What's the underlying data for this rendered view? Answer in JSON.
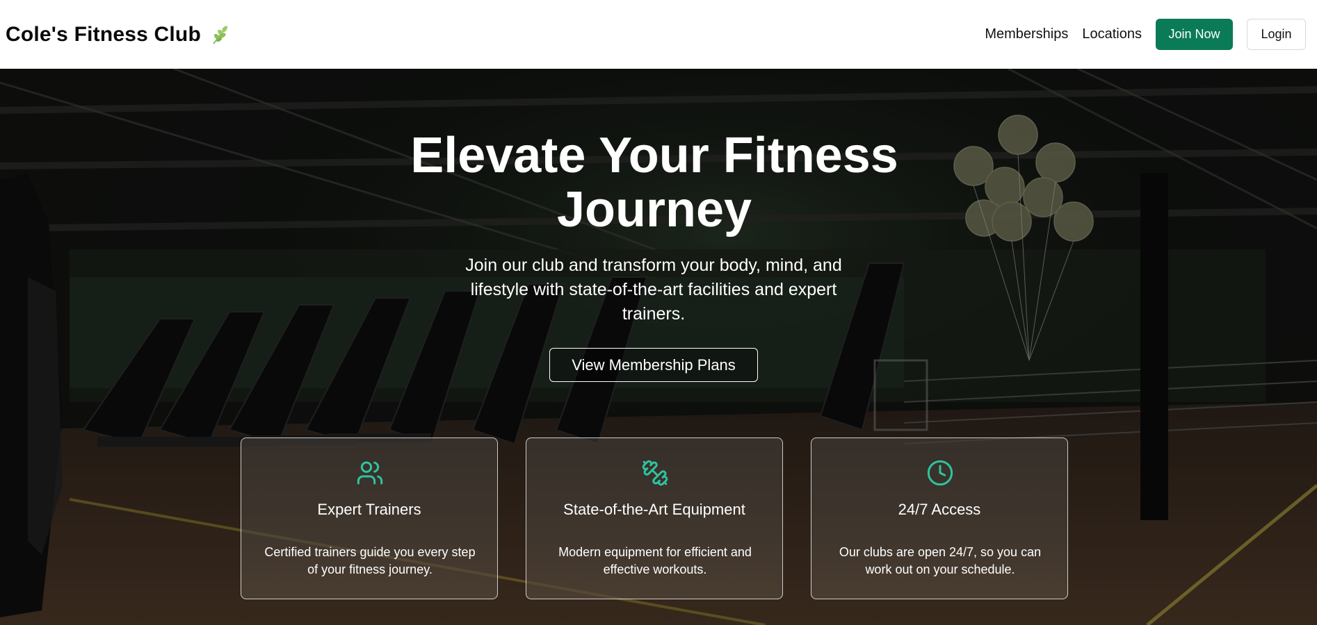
{
  "brand": {
    "title": "Cole's Fitness Club",
    "logo_icon": "leaf-icon",
    "logo_color": "#8bbf5a"
  },
  "nav": {
    "links": [
      "Memberships",
      "Locations"
    ],
    "join_label": "Join Now",
    "login_label": "Login",
    "accent_color": "#0b7a57"
  },
  "hero": {
    "title": "Elevate Your Fitness Journey",
    "subtitle": "Join our club and transform your body, mind, and lifestyle with state-of-the-art facilities and expert trainers.",
    "cta_label": "View Membership Plans"
  },
  "features": [
    {
      "icon": "users-icon",
      "title": "Expert Trainers",
      "description": "Certified trainers guide you every step of your fitness journey."
    },
    {
      "icon": "dumbbell-icon",
      "title": "State-of-the-Art Equipment",
      "description": "Modern equipment for efficient and effective workouts."
    },
    {
      "icon": "clock-icon",
      "title": "24/7 Access",
      "description": "Our clubs are open 24/7, so you can work out on your schedule."
    }
  ],
  "icon_color": "#2ec4a0"
}
